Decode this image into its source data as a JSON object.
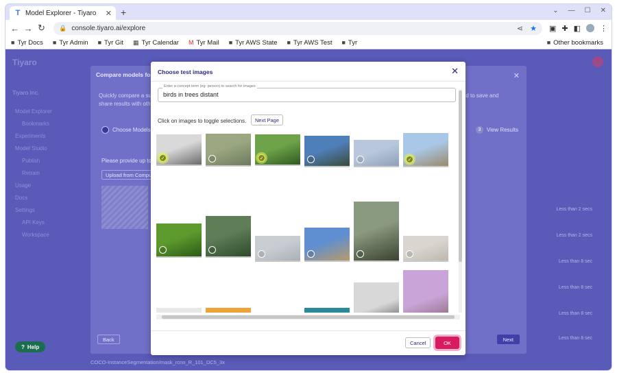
{
  "browser": {
    "tab_title": "Model Explorer - Tiyaro",
    "url": "console.tiyaro.ai/explore",
    "bookmarks": [
      "Tyr Docs",
      "Tyr Admin",
      "Tyr Git",
      "Tyr Calendar",
      "Tyr Mail",
      "Tyr AWS State",
      "Tyr AWS Test",
      "Tyr"
    ],
    "other_bookmarks": "Other bookmarks"
  },
  "background": {
    "app_name": "Tiyaro",
    "org": "Tiyaro Inc.",
    "nav": [
      "Model Explorer",
      "Bookmarks",
      "Experiments",
      "Model Studio",
      "Publish",
      "Retrain",
      "Usage",
      "Docs",
      "Settings",
      "API Keys",
      "Workspace"
    ],
    "panel_title": "Compare models for",
    "panel_text_left": "Quickly compare a su share results with oth",
    "panel_text_right": ", and to save and",
    "step_current": "Choose Models",
    "step_last_num": "3",
    "step_last": "View Results",
    "provide_text": "Please provide up to",
    "upload_label": "Upload from Compu",
    "back_label": "Back",
    "next_label": "Next",
    "help_label": "Help",
    "latencies": [
      "Less than 2 secs",
      "Less than 2 secs",
      "Less than 8 sec",
      "Less than 8 sec",
      "Less than 8 sec",
      "Less than 8 sec"
    ],
    "bottom_row": "COCO-InstanceSegmentation/mask_rcnn_R_101_DC5_3x"
  },
  "modal": {
    "title": "Choose test images",
    "search_label": "Enter a concept term (eg: person) to search for images",
    "search_value": "birds in trees distant",
    "hint": "Click on images to toggle selections.",
    "next_page": "Next Page",
    "cancel": "Cancel",
    "ok": "OK"
  },
  "images": [
    {
      "name": "img-branches-bw",
      "selected": true,
      "c1": "#d9d9d9",
      "c2": "#6b6b6b"
    },
    {
      "name": "img-tree-branches",
      "selected": false,
      "c1": "#9aa780",
      "c2": "#6c7a5e"
    },
    {
      "name": "img-green-leaves",
      "selected": true,
      "c1": "#6fa34a",
      "c2": "#2f5a22"
    },
    {
      "name": "img-blue-branches",
      "selected": false,
      "c1": "#4f7fb8",
      "c2": "#3a4a3a"
    },
    {
      "name": "img-pale-sky-bird",
      "selected": false,
      "c1": "#b8c7dc",
      "c2": "#8da0b8"
    },
    {
      "name": "img-bare-tree-sky",
      "selected": true,
      "c1": "#a9c8e8",
      "c2": "#9a8a6a"
    },
    {
      "name": "img-green-foliage",
      "selected": false,
      "c1": "#5d9a2d",
      "c2": "#2c5a18"
    },
    {
      "name": "img-dense-forest",
      "selected": false,
      "c1": "#5f7e58",
      "c2": "#2e4a2c"
    },
    {
      "name": "img-grey-sky-birds",
      "selected": false,
      "c1": "#c8cdd2",
      "c2": "#a9b0b6"
    },
    {
      "name": "img-blue-sky-branches",
      "selected": false,
      "c1": "#5f8fd0",
      "c2": "#b99a6a"
    },
    {
      "name": "img-forest-path-person",
      "selected": false,
      "c1": "#8a9a80",
      "c2": "#3a4330"
    },
    {
      "name": "img-flying-birds-light",
      "selected": false,
      "c1": "#d9d5cf",
      "c2": "#bdb7ad"
    },
    {
      "name": "img-bw-bird-branch",
      "selected": false,
      "c1": "#e8e8e8",
      "c2": "#1e1e1e"
    },
    {
      "name": "img-sunset-palms",
      "selected": false,
      "c1": "#f0a23a",
      "c2": "#3a2410"
    },
    {
      "name": "img-dusk-tree",
      "selected": false,
      "c1": "#e58a2e",
      "c2": "#101a3a"
    },
    {
      "name": "img-macaws",
      "selected": false,
      "c1": "#2a8a9a",
      "c2": "#e0b030"
    },
    {
      "name": "img-bw-palm-canopy",
      "selected": false,
      "c1": "#d8d8d8",
      "c2": "#1a1a1a"
    },
    {
      "name": "img-woman-pink-sky",
      "selected": false,
      "c1": "#c9a4d8",
      "c2": "#6a4a4a"
    }
  ]
}
